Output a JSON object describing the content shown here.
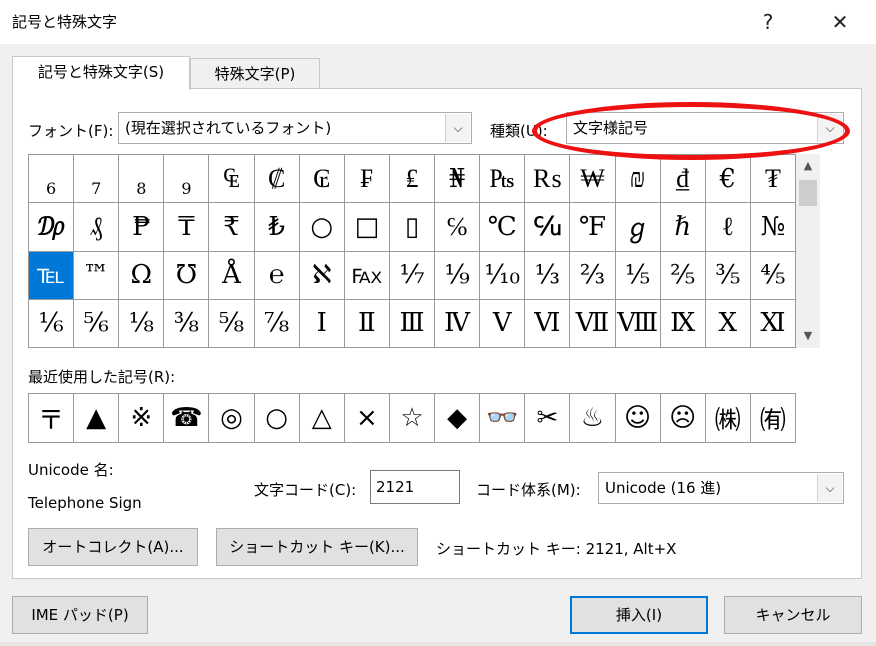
{
  "window": {
    "title": "記号と特殊文字",
    "help_glyph": "?",
    "close_glyph": "✕",
    "help_icon": "question-mark-icon",
    "close_icon": "close-icon"
  },
  "tabs": [
    {
      "label": "記号と特殊文字(S)",
      "active": true
    },
    {
      "label": "特殊文字(P)",
      "active": false
    }
  ],
  "font": {
    "label": "フォント(F):",
    "value": "(現在選択されているフォント)"
  },
  "subset": {
    "label": "種類(U):",
    "value": "文字様記号"
  },
  "dropdown_arrow": "⌵",
  "symbols": [
    [
      "6",
      "7",
      "8",
      "9",
      "₠",
      "₡",
      "₢",
      "₣",
      "₤",
      "₦",
      "₧",
      "₨",
      "₩",
      "₪",
      "₫",
      "€",
      "₮"
    ],
    [
      "₯",
      "₰",
      "₱",
      "₸",
      "₹",
      "₺",
      "○",
      "□",
      "▯",
      "℅",
      "℃",
      "℆",
      "℉",
      "ℊ",
      "ℏ",
      "ℓ",
      "№"
    ],
    [
      "℡",
      "™",
      "Ω",
      "℧",
      "Å",
      "℮",
      "ℵ",
      "℻",
      "⅐",
      "⅑",
      "⅒",
      "⅓",
      "⅔",
      "⅕",
      "⅖",
      "⅗",
      "⅘"
    ],
    [
      "⅙",
      "⅚",
      "⅛",
      "⅜",
      "⅝",
      "⅞",
      "Ⅰ",
      "Ⅱ",
      "Ⅲ",
      "Ⅳ",
      "Ⅴ",
      "Ⅵ",
      "Ⅶ",
      "Ⅷ",
      "Ⅸ",
      "Ⅹ",
      "Ⅺ"
    ]
  ],
  "selected_symbol": "℡",
  "scrollbar": {
    "up": "▲",
    "down": "▼"
  },
  "recent": {
    "label": "最近使用した記号(R):",
    "items": [
      "〒",
      "▲",
      "※",
      "☎",
      "◎",
      "○",
      "△",
      "×",
      "☆",
      "◆",
      "👓",
      "✂",
      "♨",
      "☺",
      "☹",
      "㈱",
      "㈲"
    ]
  },
  "unicode_name": {
    "label": "Unicode 名:",
    "value": "Telephone Sign"
  },
  "char_code": {
    "label": "文字コード(C):",
    "value": "2121"
  },
  "code_system": {
    "label": "コード体系(M):",
    "value": "Unicode (16 進)"
  },
  "buttons": {
    "autocorrect": "オートコレクト(A)...",
    "shortcut_key": "ショートカット キー(K)...",
    "ime_pad": "IME パッド(P)",
    "insert": "挿入(I)",
    "cancel": "キャンセル"
  },
  "shortcut_info": "ショートカット キー: 2121, Alt+X",
  "annotation_color": "#ee1111"
}
